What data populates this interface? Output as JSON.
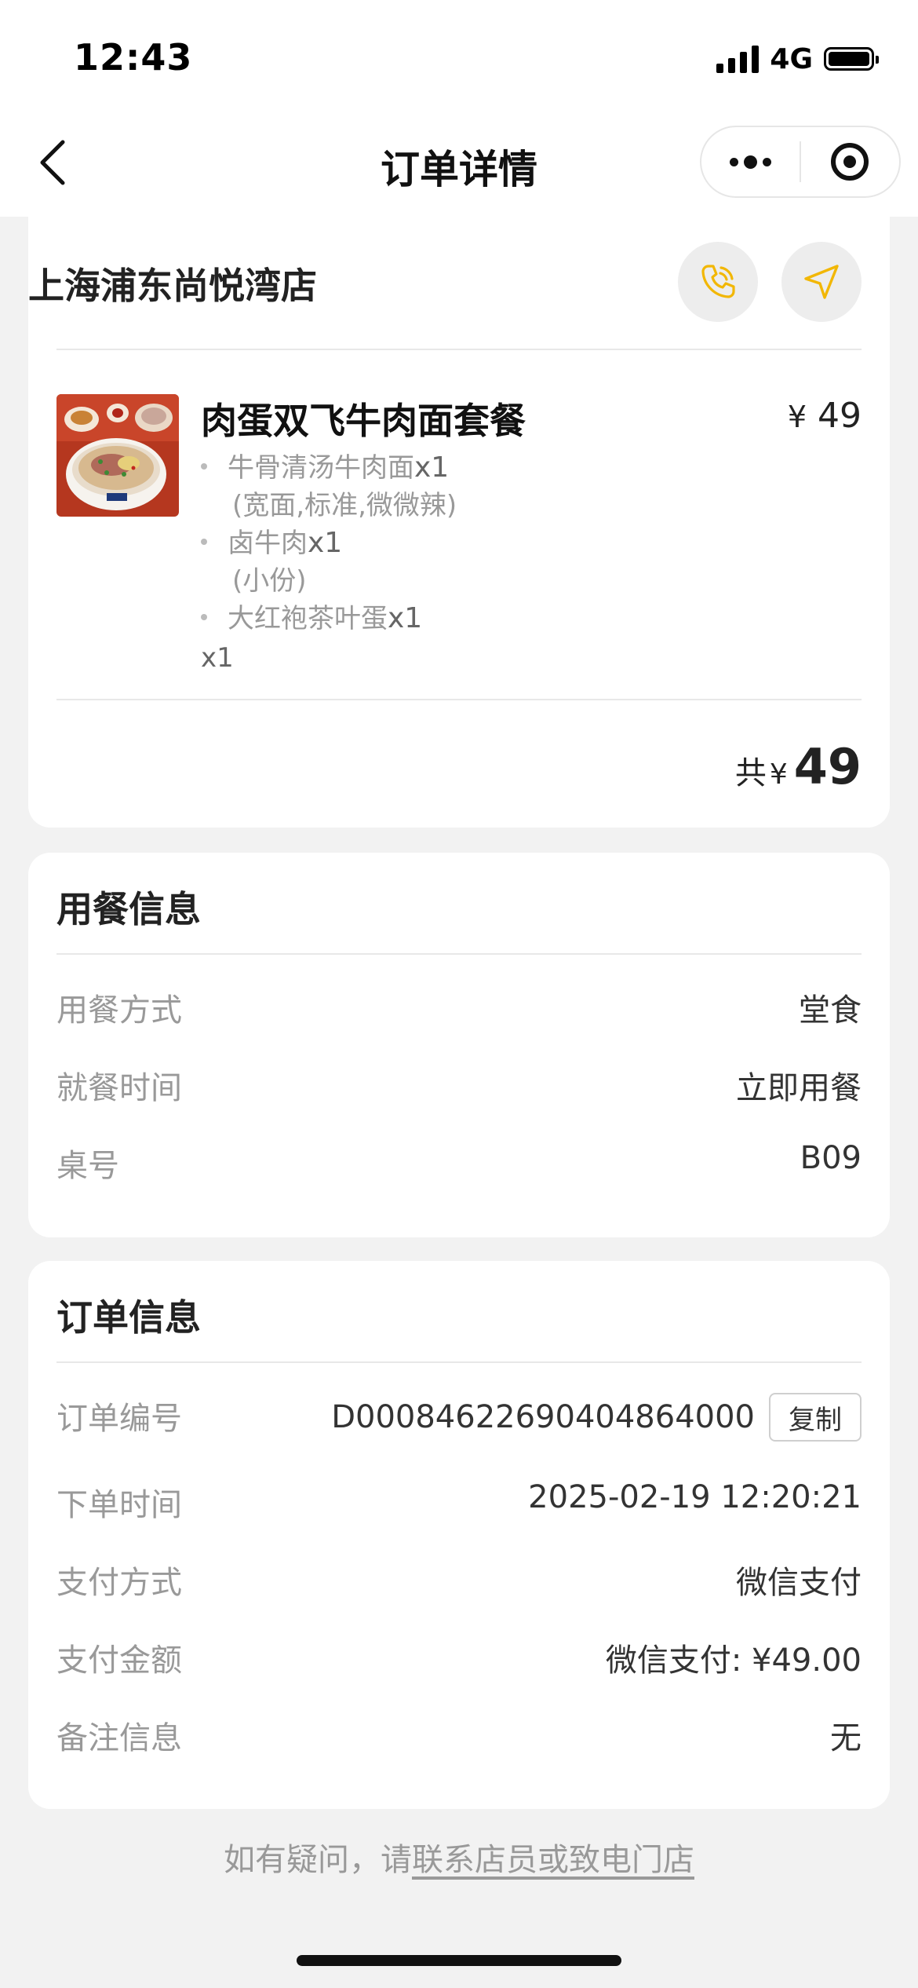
{
  "status_bar": {
    "time": "12:43",
    "network": "4G"
  },
  "nav": {
    "title": "订单详情"
  },
  "store": {
    "name": "上海浦东尚悦湾店",
    "phone_icon": "phone-icon",
    "navigate_icon": "navigation-arrow-icon",
    "item": {
      "name": "肉蛋双飞牛肉面套餐",
      "currency": "¥",
      "price": "49",
      "sub_items": [
        {
          "name": "牛骨清汤牛肉面",
          "qty": "x1",
          "spec": "(宽面,标准,微微辣)"
        },
        {
          "name": "卤牛肉",
          "qty": "x1",
          "spec": "(小份)"
        },
        {
          "name": "大红袍茶叶蛋",
          "qty": "x1",
          "spec": ""
        }
      ],
      "qty": "x1"
    },
    "total": {
      "label": "共",
      "currency": "¥",
      "amount": "49"
    }
  },
  "dining": {
    "title": "用餐信息",
    "rows": [
      {
        "label": "用餐方式",
        "value": "堂食"
      },
      {
        "label": "就餐时间",
        "value": "立即用餐"
      },
      {
        "label": "桌号",
        "value": "B09"
      }
    ]
  },
  "order": {
    "title": "订单信息",
    "copy_label": "复制",
    "rows": [
      {
        "label": "订单编号",
        "value": "D00084622690404864000"
      },
      {
        "label": "下单时间",
        "value": "2025-02-19 12:20:21"
      },
      {
        "label": "支付方式",
        "value": "微信支付"
      },
      {
        "label": "支付金额",
        "value": "微信支付: ¥49.00"
      },
      {
        "label": "备注信息",
        "value": "无"
      }
    ]
  },
  "footer": {
    "prefix": "如有疑问，请",
    "link": "联系店员或致电门店"
  },
  "colors": {
    "accent": "#f2b705",
    "background": "#f2f2f2",
    "card": "#ffffff",
    "muted": "#999999"
  }
}
